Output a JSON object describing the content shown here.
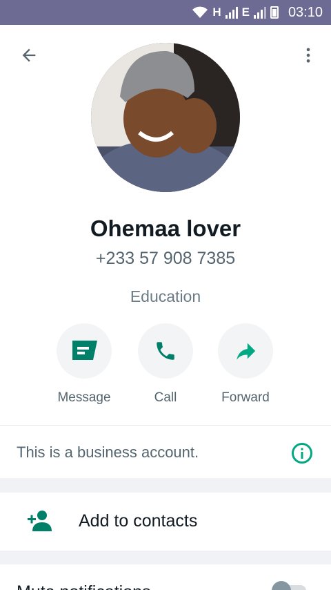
{
  "status_bar": {
    "network_1": "H",
    "network_2": "E",
    "time": "03:10",
    "icons": [
      "wifi-icon",
      "signal-icon",
      "battery-icon"
    ]
  },
  "header": {
    "back_icon": "arrow-left-icon",
    "menu_icon": "more-vert-icon"
  },
  "contact": {
    "name": "Ohemaa lover",
    "phone": "+233 57 908 7385",
    "category": "Education"
  },
  "actions": [
    {
      "label": "Message",
      "icon": "message-icon"
    },
    {
      "label": "Call",
      "icon": "phone-icon"
    },
    {
      "label": "Forward",
      "icon": "forward-icon"
    }
  ],
  "business_notice": {
    "text": "This is a business account.",
    "icon": "info-icon"
  },
  "add_contacts": {
    "label": "Add to contacts",
    "icon": "person-add-icon"
  },
  "mute": {
    "label": "Mute notifications",
    "enabled": false
  },
  "colors": {
    "status_bar": "#6d6a93",
    "accent": "#00a884",
    "icon_green": "#008069",
    "text_primary": "#111b21",
    "text_secondary": "#54656f"
  }
}
